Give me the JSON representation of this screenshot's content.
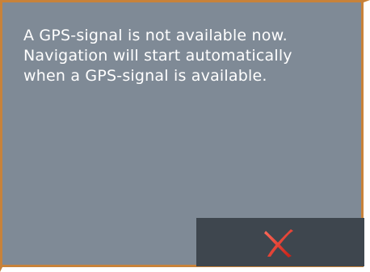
{
  "dialog": {
    "message": "A GPS-signal is not available now.\nNavigation will start automatically\nwhen a GPS-signal is available.",
    "close_button": {
      "icon": "close-icon",
      "icon_color": "#e23a2e"
    }
  },
  "colors": {
    "background": "#7f8a96",
    "border": "#c8823a",
    "button": "#3e464e",
    "text": "#ffffff"
  }
}
